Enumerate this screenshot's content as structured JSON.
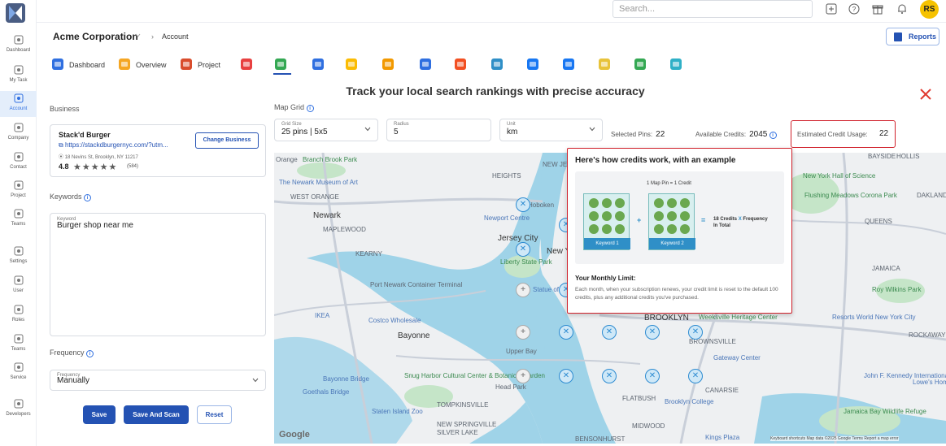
{
  "app": {
    "accent": "#2452b3",
    "highlight_border": "#d0202a"
  },
  "rail": {
    "items": [
      {
        "label": "Dashboard",
        "icon": "dashboard-icon"
      },
      {
        "label": "My Task",
        "icon": "task-icon"
      },
      {
        "label": "Account",
        "icon": "account-icon",
        "active": true
      },
      {
        "label": "Company",
        "icon": "company-icon"
      },
      {
        "label": "Contact",
        "icon": "contact-icon"
      },
      {
        "label": "Project",
        "icon": "project-icon"
      },
      {
        "label": "Teams",
        "icon": "teams-icon"
      },
      {
        "label": "Settings",
        "icon": "settings-icon"
      },
      {
        "label": "User",
        "icon": "user-icon"
      },
      {
        "label": "Roles",
        "icon": "roles-icon"
      },
      {
        "label": "Teams",
        "icon": "teams-icon"
      },
      {
        "label": "Service",
        "icon": "service-icon"
      },
      {
        "label": "Developers",
        "icon": "developers-icon"
      }
    ]
  },
  "topbar": {
    "search_placeholder": "Search...",
    "avatar_initials": "RS"
  },
  "breadcrumb": {
    "company": "Acme Corporation",
    "separator": "›",
    "current": "Account"
  },
  "reports_label": "Reports",
  "tools": [
    {
      "label": "Dashboard",
      "icon": "dashboard-tool-icon"
    },
    {
      "label": "Overview",
      "icon": "overview-tool-icon"
    },
    {
      "label": "Project",
      "icon": "project-tool-icon"
    },
    {
      "label": "",
      "icon": "trend-chart-icon"
    },
    {
      "label": "",
      "icon": "map-rank-icon",
      "active": true
    },
    {
      "label": "",
      "icon": "google-business-icon"
    },
    {
      "label": "",
      "icon": "google-ads-icon"
    },
    {
      "label": "",
      "icon": "analytics-icon"
    },
    {
      "label": "",
      "icon": "seo-tools-icon"
    },
    {
      "label": "",
      "icon": "microsoft-icon"
    },
    {
      "label": "",
      "icon": "bing-icon"
    },
    {
      "label": "",
      "icon": "meta-ads-icon"
    },
    {
      "label": "",
      "icon": "facebook-icon"
    },
    {
      "label": "",
      "icon": "reviews-icon"
    },
    {
      "label": "",
      "icon": "citations-icon"
    },
    {
      "label": "",
      "icon": "local-pack-icon"
    }
  ],
  "headline": "Track your local search rankings with precise accuracy",
  "left": {
    "business_label": "Business",
    "business": {
      "name": "Stack'd Burger",
      "url": "https://stackdburgernyc.com/?utm...",
      "address": "18 Nevins St, Brooklyn, NY 11217",
      "rating": "4.8",
      "stars": "★★★★★",
      "review_count": "(584)",
      "change_label": "Change Business"
    },
    "keywords_label": "Keywords",
    "keyword_field_label": "Keyword",
    "keyword_value": "Burger shop near me",
    "frequency_label": "Frequency",
    "frequency_field_label": "Frequency",
    "frequency_value": "Manually",
    "save_label": "Save",
    "save_scan_label": "Save And Scan",
    "reset_label": "Reset"
  },
  "grid": {
    "title": "Map Grid",
    "grid_size_label": "Grid Size",
    "grid_size_value": "25 pins | 5x5",
    "radius_label": "Radius",
    "radius_value": "5",
    "unit_label": "Unit",
    "unit_value": "km",
    "selected_pins_label": "Selected Pins:",
    "selected_pins_value": "22",
    "available_credits_label": "Available Credits:",
    "available_credits_value": "2045",
    "estimated_label": "Estimated Credit Usage:",
    "estimated_value": "22"
  },
  "popover": {
    "title": "Here's how credits work, with an example",
    "note": "1 Map Pin = 1 Credit",
    "keyword1": "Keyword 1",
    "keyword2": "Keyword 2",
    "plus": "+",
    "equals": "=",
    "total_a": "18 Credits",
    "total_x": "X",
    "total_b": "Frequency",
    "total_c": "In Total",
    "monthly_title": "Your Monthly Limit:",
    "monthly_desc": "Each month, when your subscription renews, your credit limit is reset to the default 100 credits, plus any additional credits you've purchased."
  },
  "map": {
    "labels": [
      "Orange",
      "Branch Brook Park",
      "The Newark Museum of Art",
      "Newark",
      "Jersey City",
      "Liberty State Park",
      "Port Newark Container Terminal",
      "IKEA",
      "Costco Wholesale",
      "Bayonne",
      "Bayonne Bridge",
      "Snug Harbor Cultural Center & Botanical Garden",
      "Goethals Bridge",
      "Staten Island Zoo",
      "Head Park",
      "BROOKLYN",
      "Weeksville Heritage Center",
      "Gateway Center",
      "Brooklyn College",
      "FLATBUSH",
      "CANARSIE",
      "QUEENS",
      "JAMAICA",
      "Roy Wilkins Park",
      "Resorts World New York City",
      "New York Hall of Science",
      "Flushing Meadows Corona Park",
      "HOLLIS",
      "BAYSIDE",
      "John F. Kennedy International Airport",
      "Jamaica Bay Wildlife Refuge",
      "Lowe's Home Improvement",
      "Kings Plaza",
      "Newport Centre",
      "Hoboken",
      "New York",
      "BROWNSVILLE",
      "TOMPKINSVILLE",
      "NEW SPRINGVILLE",
      "MIDWOOD",
      "BENSONHURST",
      "SILVER LAKE",
      "DAKLAND GARDENS",
      "WEST ORANGE",
      "MAPLEWOOD",
      "KEARNY",
      "HEIGHTS",
      "NEW JERSEY TURNPIKE",
      "Upper Bay",
      "ROCKAWAY",
      "Statue of Liberty"
    ],
    "footer": "Keyboard shortcuts   Map data ©2025 Google   Terms   Report a map error",
    "google": "Google"
  }
}
